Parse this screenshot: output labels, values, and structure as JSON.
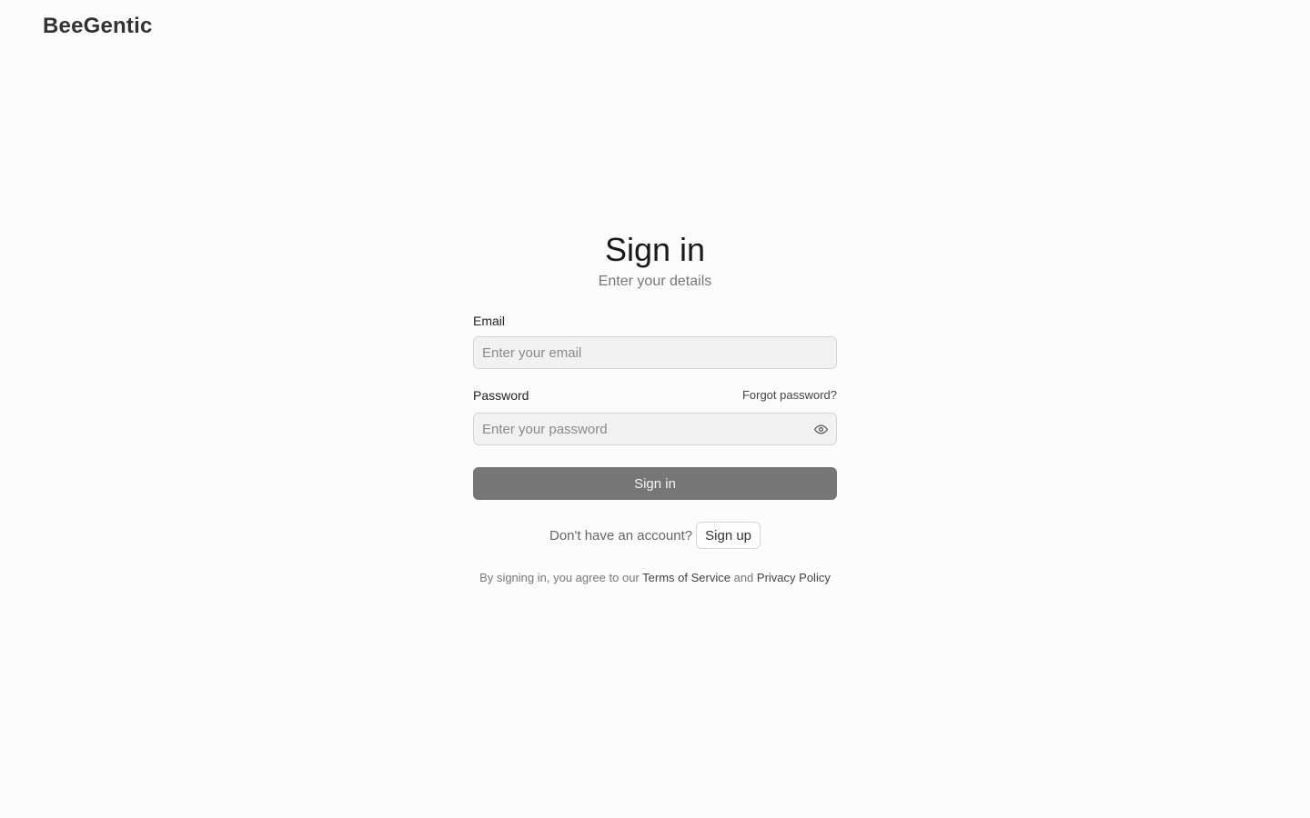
{
  "brand": {
    "name": "BeeGentic"
  },
  "header": {
    "title": "Sign in",
    "subtitle": "Enter your details"
  },
  "form": {
    "email": {
      "label": "Email",
      "placeholder": "Enter your email",
      "value": ""
    },
    "password": {
      "label": "Password",
      "placeholder": "Enter your password",
      "value": "",
      "forgot_label": "Forgot password?",
      "toggle_icon": "eye-icon"
    },
    "submit_label": "Sign in"
  },
  "signup": {
    "prompt": "Don't have an account?",
    "button_label": "Sign up"
  },
  "legal": {
    "prefix": "By signing in, you agree to our",
    "terms_label": "Terms of Service",
    "conjunction": "and",
    "privacy_label": "Privacy Policy"
  },
  "colors": {
    "background": "#fcfcfc",
    "primary_button": "#767676",
    "input_background": "#f1f1f1",
    "input_border": "#d4d4d4"
  }
}
